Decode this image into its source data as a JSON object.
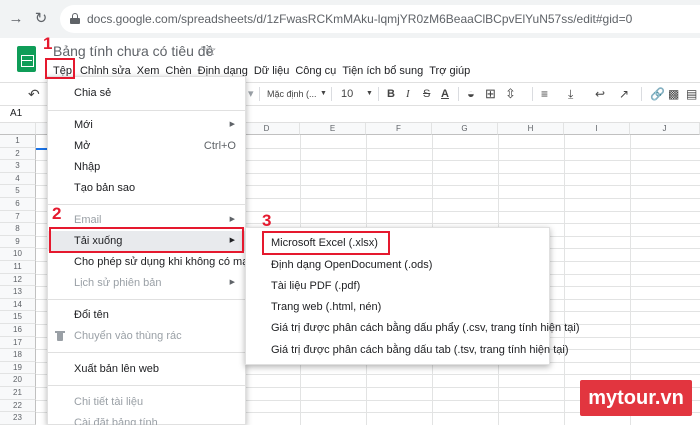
{
  "browser": {
    "url": "docs.google.com/spreadsheets/d/1zFwasRCKmMAku-lqmjYR0zM6BeaaClBCpvElYuN57ss/edit#gid=0",
    "back_icon": "arrow-right-icon",
    "reload_icon": "reload-icon",
    "lock_icon": "lock-icon"
  },
  "sheets": {
    "title": "Bảng tính chưa có tiêu đề",
    "star_icon": "star-icon",
    "menus": [
      "Tệp",
      "Chỉnh sửa",
      "Xem",
      "Chèn",
      "Định dạng",
      "Dữ liệu",
      "Công cụ",
      "Tiện ích bổ sung",
      "Trợ giúp"
    ]
  },
  "toolbar": {
    "font": "Mặc định (...",
    "size": "10",
    "bold": "B",
    "italic": "I",
    "strike": "S",
    "text_color": "A"
  },
  "formula_bar": {
    "cell_ref": "A1"
  },
  "grid": {
    "columns": [
      "A",
      "B",
      "C",
      "D",
      "E",
      "F",
      "G",
      "H",
      "I",
      "J"
    ],
    "rows": [
      "1",
      "2",
      "3",
      "4",
      "5",
      "6",
      "7",
      "8",
      "9",
      "10",
      "11",
      "12",
      "13",
      "14",
      "15",
      "16",
      "17",
      "18",
      "19",
      "20",
      "21",
      "22",
      "23"
    ]
  },
  "file_menu": {
    "share": "Chia sẻ",
    "new": "Mới",
    "open": "Mở",
    "open_shortcut": "Ctrl+O",
    "import": "Nhập",
    "make_copy": "Tạo bản sao",
    "email": "Email",
    "download": "Tải xuống",
    "offline": "Cho phép sử dụng khi không có mạng",
    "version_history": "Lịch sử phiên bản",
    "rename": "Đổi tên",
    "trash": "Chuyển vào thùng rác",
    "publish": "Xuất bản lên web",
    "details": "Chi tiết tài liệu",
    "settings": "Cài đặt bảng tính"
  },
  "download_menu": {
    "items": [
      "Microsoft Excel (.xlsx)",
      "Định dạng OpenDocument (.ods)",
      "Tài liệu PDF (.pdf)",
      "Trang web (.html, nén)",
      "Giá trị được phân cách bằng dấu phẩy (.csv, trang tính hiện tại)",
      "Giá trị được phân cách bằng dấu tab (.tsv, trang tính hiện tại)"
    ]
  },
  "annotations": {
    "step1": "1",
    "step2": "2",
    "step3": "3"
  },
  "watermark": "mytour.vn",
  "colors": {
    "annotation_red": "#e5192e",
    "sheets_green": "#0f9d58",
    "watermark_red": "#e2353f"
  }
}
